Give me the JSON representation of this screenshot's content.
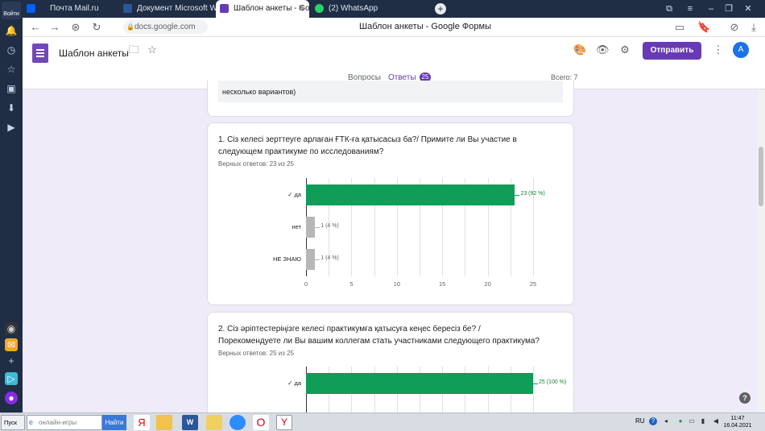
{
  "browser": {
    "login_label": "Войти",
    "tabs": [
      {
        "title": "Почта Mail.ru",
        "color": "#005ff9"
      },
      {
        "title": "Документ Microsoft Word",
        "color": "#2b579a"
      },
      {
        "title": "Шаблон анкеты - Goog",
        "color": "#673ab7"
      },
      {
        "title": "(2) WhatsApp",
        "color": "#25d366"
      }
    ],
    "url": "docs.google.com",
    "page_title": "Шаблон анкеты - Google Формы"
  },
  "forms": {
    "title": "Шаблон анкеты",
    "send_label": "Отправить",
    "avatar_letter": "A",
    "tab_questions": "Вопросы",
    "tab_answers": "Ответы",
    "answers_count": "25",
    "total": "Всего: 7",
    "accent": "#673ab7"
  },
  "prev_card": {
    "text": "несколько вариантов)"
  },
  "questions": [
    {
      "title": "1. Сіз келесі зерттеуге арлаған ҒТК-ға қатысасыз ба?/ Примите ли Вы участие в следующем практикуме по исследованиям?",
      "summary": "Верных ответов: 23 из 25"
    },
    {
      "title": "2. Сіз әріптестеріңізге келесі практикумға қатысуға кеңес бересіз бе? / Порекомендуете ли Вы вашим коллегам стать участниками следующего практикума?",
      "summary": "Верных ответов: 25 из 25"
    }
  ],
  "chart_data": [
    {
      "type": "bar",
      "orientation": "horizontal",
      "categories": [
        "✓ да",
        "нет",
        "НЕ ЗНАЮ"
      ],
      "values": [
        23,
        1,
        1
      ],
      "labels": [
        "23 (92 %)",
        "1 (4 %)",
        "1 (4 %)"
      ],
      "correct": [
        true,
        false,
        false
      ],
      "xticks": [
        "0",
        "5",
        "10",
        "15",
        "20",
        "25"
      ],
      "xlim": [
        0,
        25
      ],
      "colors": {
        "correct": "#0f9d58",
        "incorrect": "#b7b7b7"
      }
    },
    {
      "type": "bar",
      "orientation": "horizontal",
      "categories": [
        "✓ да"
      ],
      "values": [
        25
      ],
      "labels": [
        "25 (100 %)"
      ],
      "correct": [
        true
      ],
      "xlim": [
        0,
        25
      ],
      "colors": {
        "correct": "#0f9d58",
        "incorrect": "#b7b7b7"
      }
    }
  ],
  "taskbar": {
    "start_label": "Пуск",
    "search_placeholder": "онлайн-игры",
    "search_button": "Найти",
    "lang": "RU",
    "time": "11:47",
    "date": "16.04.2021"
  }
}
